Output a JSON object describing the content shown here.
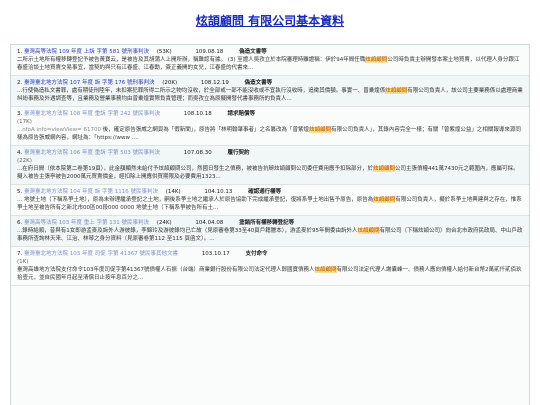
{
  "title": "炫頡顧問 有限公司基本資料",
  "highlight": "炫頡顧問",
  "items": [
    {
      "no": "1.",
      "ref": "臺灣高等法院 109 年度 上訴 字第 581 號刑事判決",
      "size": "(53K)",
      "date": "109.08.18",
      "kind": "偽造文書等",
      "s1": "二所示土地所有權移轉登記予被告黃寶云，是被告及其胡蒲人上開所辦，稱難認有據。 (3) 至證人吳孜立於本院審理時雖證稱：伊於94年間任職",
      "s2": "公司時負責主辦開發本案土地買賣，以代理人身分跟江春盛洽談土地買賣交易事宜，當契約與只有江春盛、江春勳，簽正義開的女兒，江春盛的代書來..."
    },
    {
      "no": "2.",
      "ref": "臺灣臺北地方法院 107 年度 訴 字第 176 號刑事判決",
      "size": "(20K)",
      "date": "108.12.19",
      "kind": "偽造文書等",
      "s1": "...行使偽造私文書罪，處有期徒刑陸年，未扣案犯罪所得二所示之物均沒收，於全部或一部不能沒收或不宜執行沒收時，追徵其價額。事實一、曾乗煌係",
      "s2": "有限公司負責人，該公司主要業務係以處理商業糾紛事務及外遇調查等，且業務及營業事務均由曾乗煌實際負責管理；而吳孜立為原擬開發代書事務所的負責人..."
    },
    {
      "no": "3.",
      "ref": "臺灣臺北地方法院 108 年度 重訴 字第 242 號民事判決",
      "size": "(17K)",
      "date": "108.10.18",
      "kind": "請求賠償等",
      "s0": "...nfoA info=viewView= 61700 ",
      "s1": "後，確定原告張威之網頁為「假新聞」，原告將「林明翰肇事者」之名篡改為「曾紫煌",
      "s2": "有限公司負責人」，其錄內容完全一樣；有關「曾紫煌公益」之相關報導來源同樣為原告張威網內容，網址為：「https://www ...."
    },
    {
      "no": "4.",
      "ref": "臺灣臺北地方法院 106 年度 重訴 字第 503 號民事判決",
      "size": "(22K)",
      "date": "107.08.30",
      "kind": "履行契約",
      "s1": "...在府日間（依本院第二卷第19頁），此金額顯然未給付予炫頡顧問公司，然國日發生之債務，被被告抗辯炫頡顧問公司委任費用應予扣除部分，於",
      "s2": "公司主張債權441萬7430元之範圍內，應屬可採。 擬入被告主張亭被告2000萬元買賣價金，經扣除上開應供買期限及必要費用1323..."
    },
    {
      "no": "5.",
      "ref": "臺灣臺北地方法院 104 年度 訴 字第 1116 號民事判決",
      "size": "(14K)",
      "date": "104.10.13",
      "kind": "確認通行權等",
      "s1": "... 地號土地（下稱系爭土地），原為未辦理繼承登記之土地，嗣後系爭土地之繼承人於原告協助下完成繼承登記，復將系爭土地出售予原告，原告為",
      "s2": "有限公司負責人，擬於系爭土地興建與之存在，惟系爭土地至被告所有之新北市00區00段000 0000 地號土地（下稱系爭被告所有土..."
    },
    {
      "no": "6.",
      "ref": "臺灣高等法院 103 年度 重上 字第 131 號民事判決",
      "size": "(24K)",
      "date": "104.04.08",
      "kind": "塗銷所有權移轉登記等",
      "s1": "...錄時給順，昔與有1女即游孟麥及訴外人游彼錄，李錦玲及游彼錄均已亡故（見原審卷第33至40頁戶籍謄本），游孟麥於95年間委由訴外人",
      "s2": "有限公司（下稱炫頡公司）向台北市政府民政局、中山戶政事務所查詢林天来、江治、林琴之身分資料（見原審卷第112 至115 頁函文）。..."
    },
    {
      "no": "7.",
      "ref": "臺灣臺北地方法院 103 年度 司促 字第 41367 號民事其他文書",
      "size": "(1K)",
      "date": "103.10.17",
      "kind": "支付命令",
      "s1": "臺灣高雄地方法院支付命令103年度司促字第41367號債權人石振（台端）商業銀行股份有限公司法定代理人鄭國寶債務人",
      "s2": "有限公司法定代理人謝囊峰一、債務人應向債權人給付新台幣2萬貳仟貳佰玖拾壹元，並自民國年月起至清償日止按年息百分之..."
    }
  ]
}
